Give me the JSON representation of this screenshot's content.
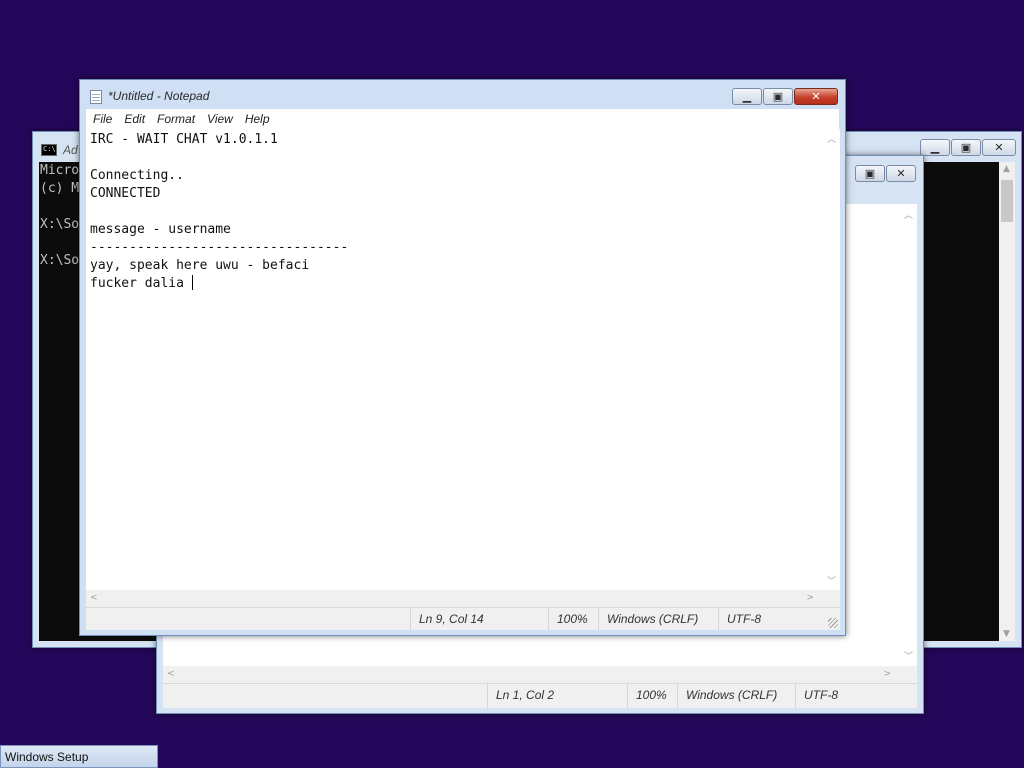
{
  "notepad": {
    "title": "*Untitled - Notepad",
    "menu": [
      "File",
      "Edit",
      "Format",
      "View",
      "Help"
    ],
    "lines": [
      "IRC - WAIT CHAT v1.0.1.1",
      "",
      "Connecting..",
      "CONNECTED",
      "",
      "message - username",
      "---------------------------------",
      "yay, speak here uwu - befaci",
      "fucker dalia "
    ],
    "status": {
      "position": "Ln 9, Col 14",
      "zoom": "100%",
      "line_ending": "Windows (CRLF)",
      "encoding": "UTF-8"
    }
  },
  "cmd_window": {
    "title_fragment": "Ad",
    "lines": [
      "Micro",
      "(c) M",
      "",
      "X:\\So",
      "",
      "X:\\So"
    ]
  },
  "notepad_back": {
    "status": {
      "position": "Ln 1, Col 2",
      "zoom": "100%",
      "line_ending": "Windows (CRLF)",
      "encoding": "UTF-8"
    }
  },
  "taskbar": {
    "setup_label": "Windows Setup"
  },
  "icons": {
    "minimize": "minimize-icon",
    "maximize": "maximize-icon",
    "close": "close-icon",
    "notepad": "notepad-icon",
    "cmd": "cmd-icon"
  },
  "colors": {
    "desktop": "#24075a",
    "close_button": "#c6402a",
    "console_bg": "#0c0c0c"
  }
}
